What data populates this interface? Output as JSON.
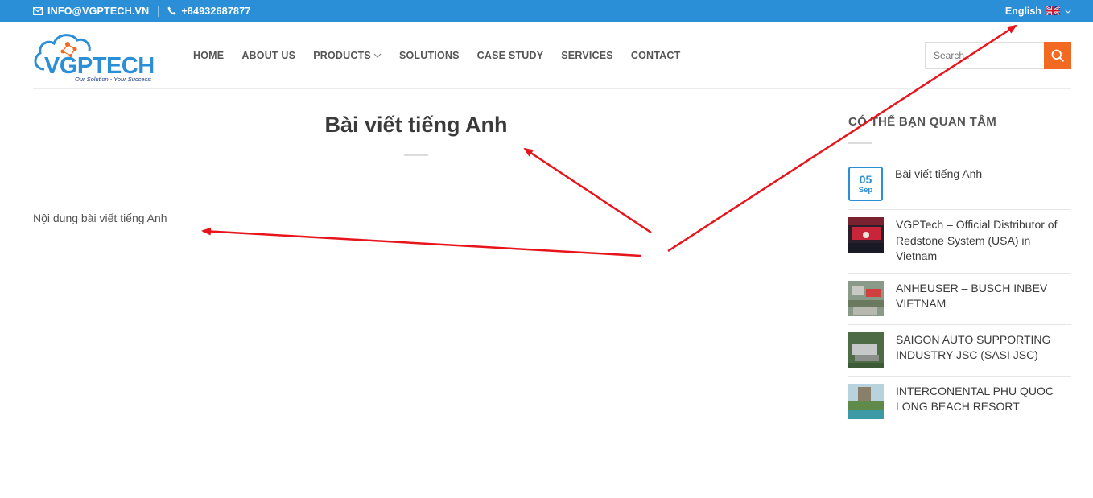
{
  "topbar": {
    "email": "INFO@VGPTECH.VN",
    "phone": "+84932687877",
    "language": "English"
  },
  "header": {
    "logo_text": "VGPTECH",
    "logo_tagline": "Our Solution - Your Success",
    "nav": [
      {
        "label": "HOME"
      },
      {
        "label": "ABOUT US"
      },
      {
        "label": "PRODUCTS"
      },
      {
        "label": "SOLUTIONS"
      },
      {
        "label": "CASE STUDY"
      },
      {
        "label": "SERVICES"
      },
      {
        "label": "CONTACT"
      }
    ],
    "search_placeholder": "Search..."
  },
  "main": {
    "title": "Bài viết tiếng Anh",
    "content": "Nội dung bài viết tiếng Anh"
  },
  "sidebar": {
    "title": "CÓ THỂ BẠN QUAN TÂM",
    "posts": [
      {
        "day": "05",
        "month": "Sep",
        "title": "Bài viết tiếng Anh"
      },
      {
        "title": "VGPTech – Official Distributor of Redstone System (USA) in Vietnam"
      },
      {
        "title": "ANHEUSER – BUSCH INBEV VIETNAM"
      },
      {
        "title": "SAIGON AUTO SUPPORTING INDUSTRY JSC (SASI JSC)"
      },
      {
        "title": "INTERCONENTAL PHU QUOC LONG BEACH RESORT"
      }
    ]
  },
  "colors": {
    "topbar": "#2b8fd8",
    "accent": "#f26a21",
    "annotation_arrow": "#e8141b"
  }
}
